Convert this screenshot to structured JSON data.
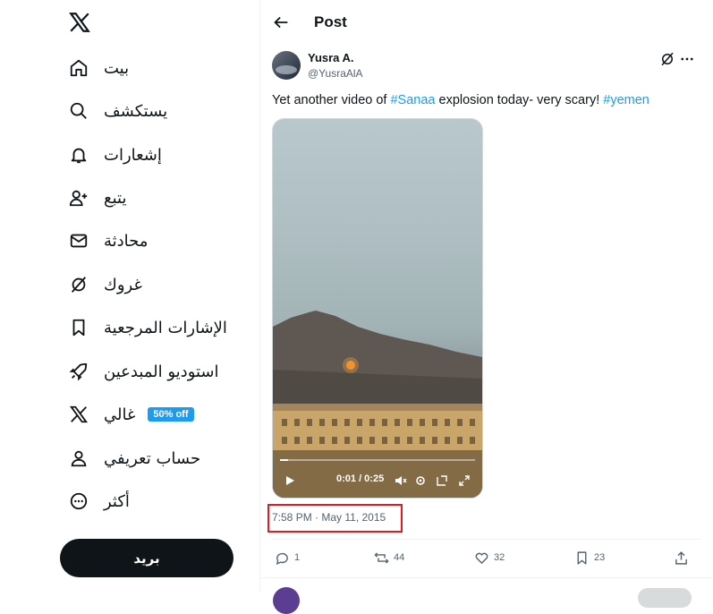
{
  "sidebar": {
    "items": [
      {
        "label": "بيت",
        "icon": "home-icon"
      },
      {
        "label": "يستكشف",
        "icon": "search-icon"
      },
      {
        "label": "إشعارات",
        "icon": "bell-icon"
      },
      {
        "label": "يتبع",
        "icon": "follow-icon"
      },
      {
        "label": "محادثة",
        "icon": "mail-icon"
      },
      {
        "label": "غروك",
        "icon": "grok-icon"
      },
      {
        "label": "الإشارات المرجعية",
        "icon": "bookmark-icon"
      },
      {
        "label": "استوديو المبدعين",
        "icon": "rocket-icon"
      },
      {
        "label": "غالي",
        "icon": "x-logo-icon",
        "badge": "50% off"
      },
      {
        "label": "حساب تعريفي",
        "icon": "person-icon"
      },
      {
        "label": "أكثر",
        "icon": "more-circle-icon"
      }
    ],
    "post_button": "بريد"
  },
  "header": {
    "title": "Post"
  },
  "tweet": {
    "author_name": "Yusra A.",
    "author_handle": "@YusraAlA",
    "text_before": "Yet another video of ",
    "hashtag1": "#Sanaa",
    "text_middle": " explosion today- very scary! ",
    "hashtag2": "#yemen",
    "video": {
      "time": "0:01 / 0:25",
      "progress": 0.04
    },
    "timestamp": "7:58 PM · May 11, 2015",
    "stats": {
      "replies": "1",
      "reposts": "44",
      "likes": "32",
      "bookmarks": "23"
    }
  },
  "colors": {
    "accent": "#1d9bf0",
    "text": "#0f1419",
    "muted": "#536471",
    "highlight": "#e01b24"
  }
}
